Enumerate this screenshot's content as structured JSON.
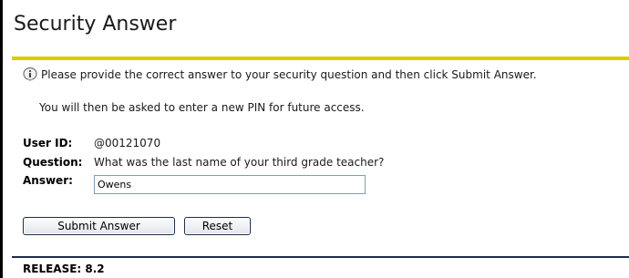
{
  "header": {
    "title": "Security Answer"
  },
  "info": {
    "icon": "info-icon",
    "message": "Please provide the correct answer to your security question and then click Submit Answer.",
    "pin_message": "You will then be asked to enter a new PIN for future access."
  },
  "form": {
    "user_id_label": "User ID:",
    "user_id_value": "@00121070",
    "question_label": "Question:",
    "question_value": "What was the last name of your third grade teacher?",
    "answer_label": "Answer:",
    "answer_value": "Owens"
  },
  "buttons": {
    "submit_label": "Submit Answer",
    "reset_label": "Reset"
  },
  "footer": {
    "release": "RELEASE: 8.2"
  },
  "colors": {
    "title_rule": "#d6cf00",
    "footer_rule": "#1c2d4a"
  }
}
